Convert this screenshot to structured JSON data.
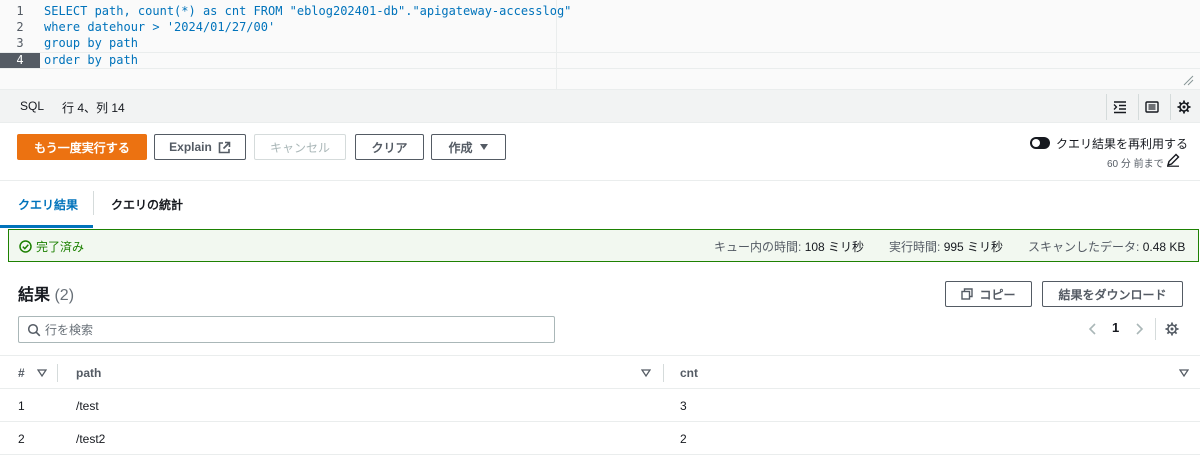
{
  "editor": {
    "lines": [
      {
        "num": "1",
        "code": "SELECT path, count(*) as cnt FROM \"eblog202401-db\".\"apigateway-accesslog\""
      },
      {
        "num": "2",
        "code": "where datehour > '2024/01/27/00'"
      },
      {
        "num": "3",
        "code": "group by path"
      },
      {
        "num": "4",
        "code": "order by path"
      }
    ],
    "active_line": 4
  },
  "statusbar": {
    "language": "SQL",
    "position": "行 4、列 14"
  },
  "actions": {
    "rerun_label": "もう一度実行する",
    "explain_label": "Explain",
    "cancel_label": "キャンセル",
    "clear_label": "クリア",
    "create_label": "作成"
  },
  "reuse": {
    "label": "クエリ結果を再利用する",
    "sub": "60 分 前まで"
  },
  "tabs": [
    {
      "label": "クエリ結果",
      "active": true
    },
    {
      "label": "クエリの統計",
      "active": false
    }
  ],
  "banner": {
    "status": "完了済み",
    "queue_label": "キュー内の時間:",
    "queue_value": "108 ミリ秒",
    "exec_label": "実行時間:",
    "exec_value": "995 ミリ秒",
    "scan_label": "スキャンしたデータ:",
    "scan_value": "0.48 KB"
  },
  "results": {
    "title": "結果",
    "count": "(2)",
    "copy_label": "コピー",
    "download_label": "結果をダウンロード",
    "search_placeholder": "行を検索",
    "page": "1",
    "columns": [
      "#",
      "path",
      "cnt"
    ],
    "rows": [
      [
        "1",
        "/test",
        "3"
      ],
      [
        "2",
        "/test2",
        "2"
      ]
    ]
  },
  "colors": {
    "accent": "#ec7211",
    "link": "#0073bb",
    "success": "#1d8102"
  }
}
